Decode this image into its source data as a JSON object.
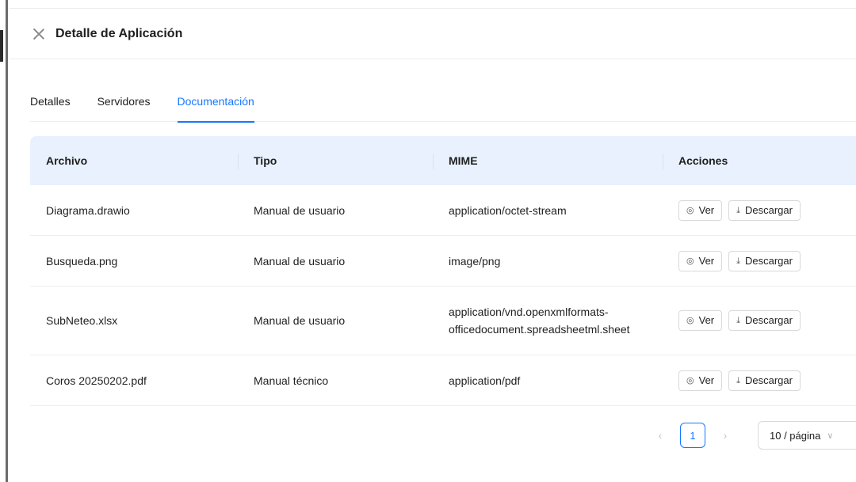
{
  "drawer": {
    "title": "Detalle de Aplicación"
  },
  "tabs": [
    {
      "label": "Detalles",
      "active": false
    },
    {
      "label": "Servidores",
      "active": false
    },
    {
      "label": "Documentación",
      "active": true
    }
  ],
  "table": {
    "headers": [
      "Archivo",
      "Tipo",
      "MIME",
      "Acciones"
    ],
    "rows": [
      {
        "archivo": "Diagrama.drawio",
        "tipo": "Manual de usuario",
        "mime_line1": "application/octet-stream",
        "mime_line2": ""
      },
      {
        "archivo": "Busqueda.png",
        "tipo": "Manual de usuario",
        "mime_line1": "image/png",
        "mime_line2": ""
      },
      {
        "archivo": "SubNeteo.xlsx",
        "tipo": "Manual de usuario",
        "mime_line1": "application/vnd.openxmlformats-",
        "mime_line2": "officedocument.spreadsheetml.sheet"
      },
      {
        "archivo": "Coros 20250202.pdf",
        "tipo": "Manual técnico",
        "mime_line1": "application/pdf",
        "mime_line2": ""
      }
    ],
    "actions": {
      "view_label": "Ver",
      "download_label": "Descargar"
    }
  },
  "pagination": {
    "current_page": "1",
    "page_size": "10 / página"
  },
  "colors": {
    "accent": "#1677ff",
    "header_bg": "#e8f1fd"
  },
  "icons": {
    "close": "close-icon",
    "view": "eye-icon",
    "download": "download-icon",
    "prev": "chevron-left-icon",
    "next": "chevron-right-icon",
    "select": "chevron-down-icon"
  }
}
